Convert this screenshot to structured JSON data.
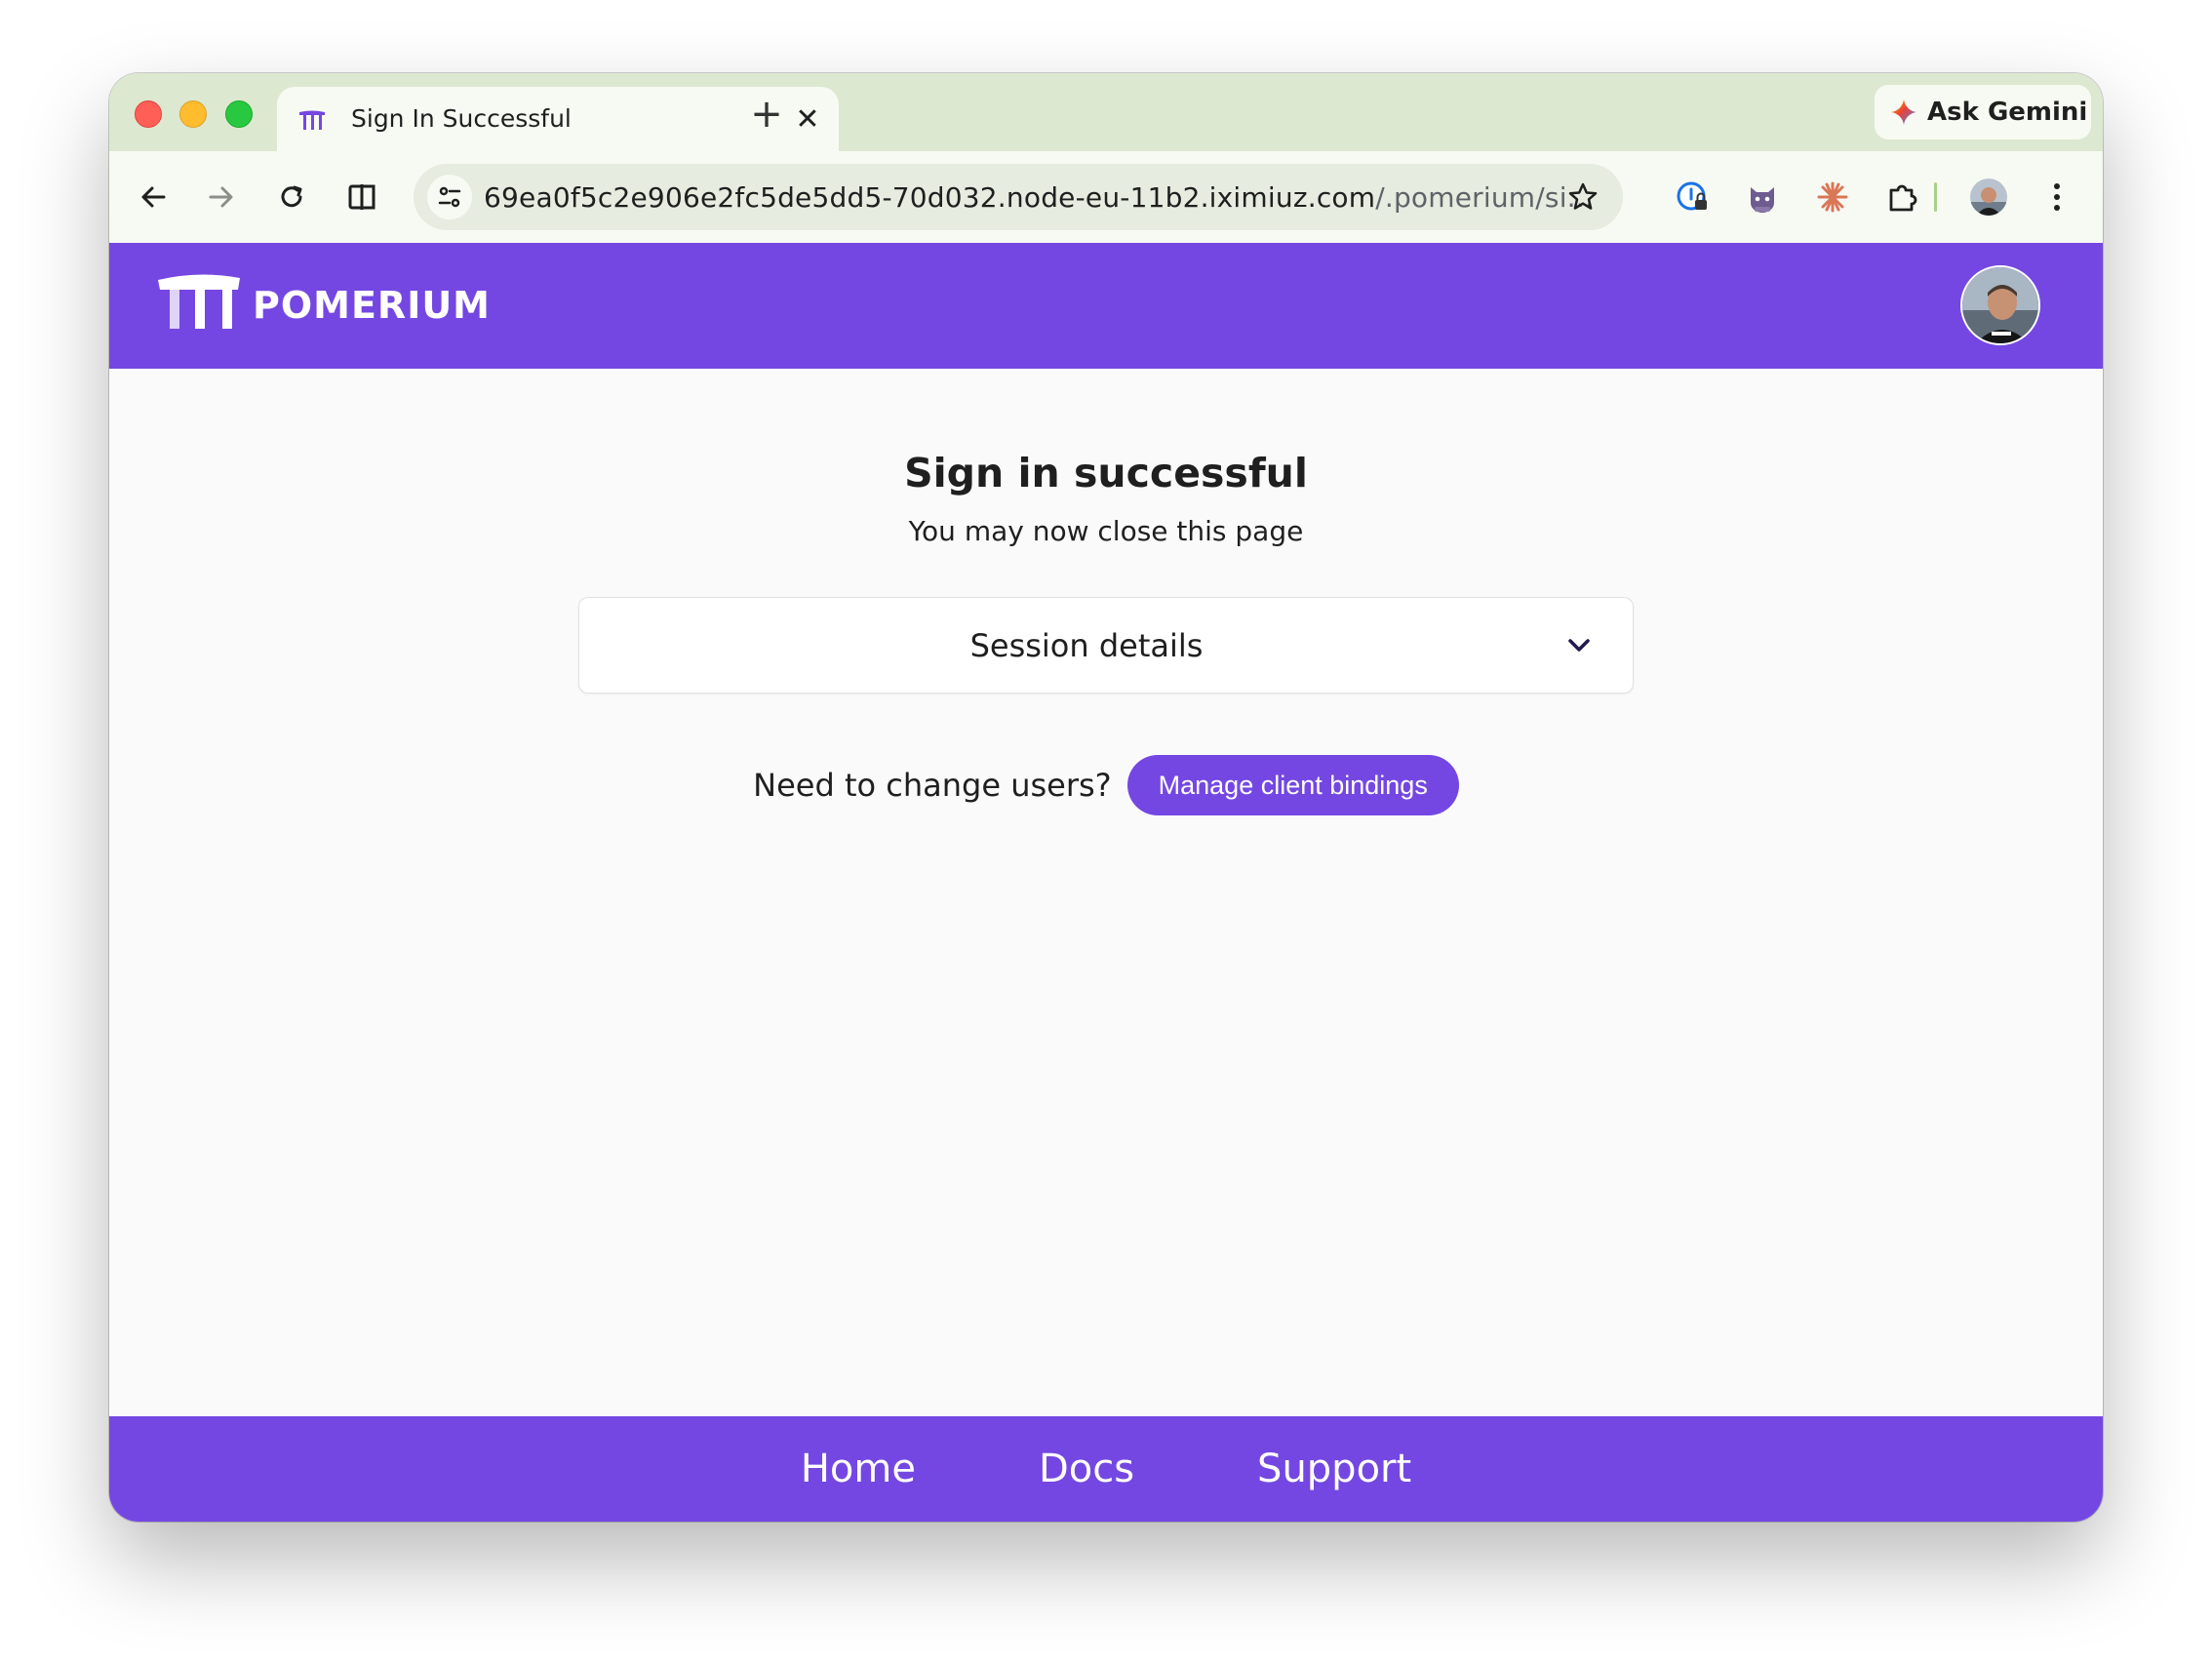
{
  "browser": {
    "tab": {
      "title": "Sign In Successful",
      "close_glyph": "✕"
    },
    "new_tab_glyph": "+",
    "gemini": {
      "label": "Ask Gemini"
    },
    "omnibox": {
      "url_host": "69ea0f5c2e906e2fc5de5dd5-70d032.node-eu-11b2.iximiuz.com",
      "url_path": "/.pomerium/si..."
    },
    "icons": {
      "back": "back-arrow-icon",
      "forward": "forward-arrow-icon",
      "reload": "reload-icon",
      "split": "split-view-icon",
      "tune": "site-settings-icon",
      "bookmark": "star-icon",
      "ext1": "password-manager-icon",
      "ext2": "cat-extension-icon",
      "ext3": "claude-extension-icon",
      "extensions": "puzzle-piece-icon",
      "menu": "kebab-menu-icon"
    }
  },
  "pomerium": {
    "brand": "POMERIUM",
    "title": "Sign in successful",
    "subtitle": "You may now close this page",
    "session_details_label": "Session details",
    "change_users_text": "Need to change users?",
    "manage_button_label": "Manage client bindings",
    "footer_links": [
      "Home",
      "Docs",
      "Support"
    ]
  },
  "colors": {
    "brand_purple": "#7447e2",
    "tabstrip_green": "#dce8d0",
    "toolbar_bg": "#f7faf2",
    "page_bg": "#fafafa"
  }
}
